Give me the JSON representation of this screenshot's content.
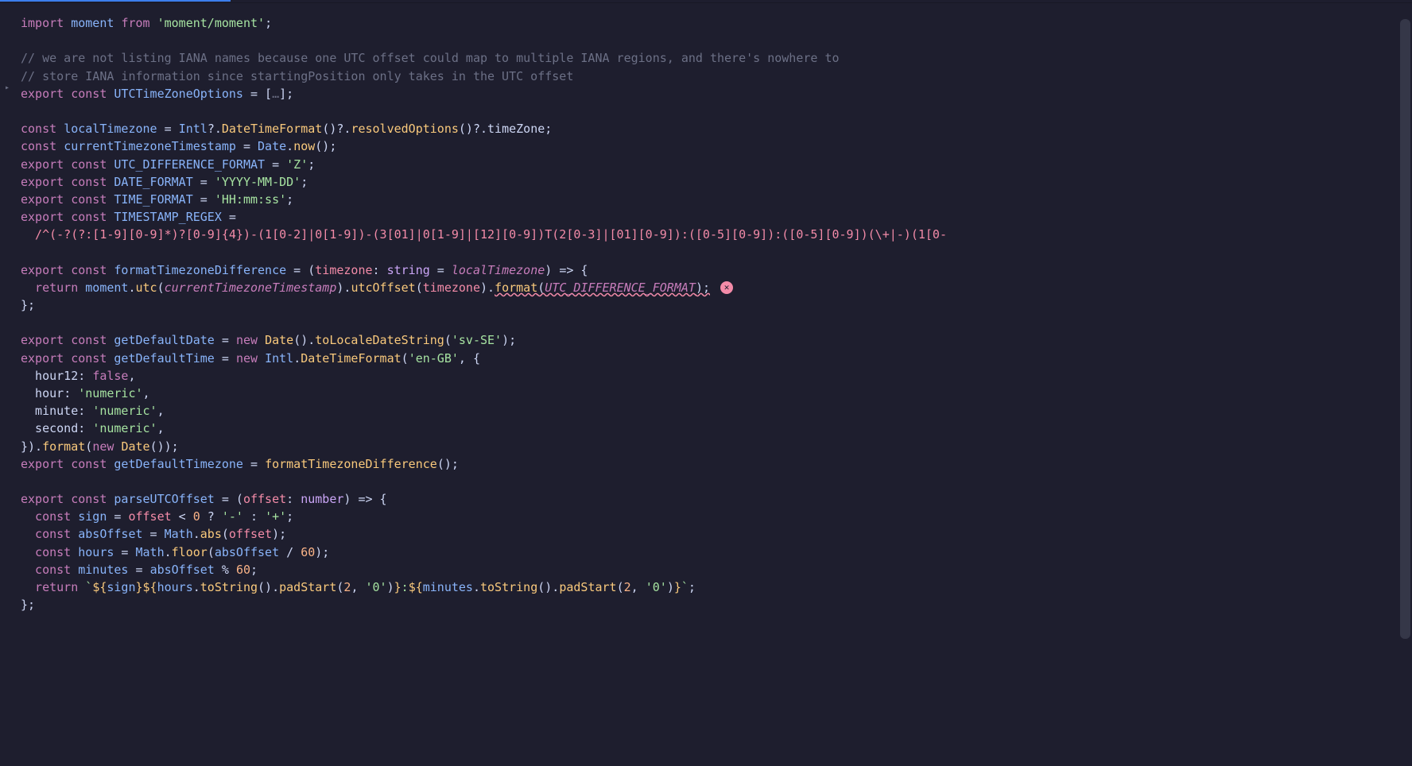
{
  "code": {
    "l1_import": "import",
    "l1_ident": "moment",
    "l1_from": "from",
    "l1_path": "'moment/moment'",
    "l1_semi": ";",
    "l3": "// we are not listing IANA names because one UTC offset could map to multiple IANA regions, and there's nowhere to",
    "l4": "// store IANA information since startingPosition only takes in the UTC offset",
    "l5_export": "export",
    "l5_const": "const",
    "l5_name": "UTCTimeZoneOptions",
    "l5_eq": " = [",
    "l5_fold": "…",
    "l5_end": "];",
    "l7_const": "const",
    "l7_name": "localTimezone",
    "l7_eq": " = ",
    "l7_intl": "Intl",
    "l7_q1": "?.",
    "l7_dtf": "DateTimeFormat",
    "l7_p1": "()?.",
    "l7_ro": "resolvedOptions",
    "l7_p2": "()?.",
    "l7_tz": "timeZone",
    "l7_semi": ";",
    "l8_const": "const",
    "l8_name": "currentTimezoneTimestamp",
    "l8_eq": " = ",
    "l8_date": "Date",
    "l8_dot": ".",
    "l8_now": "now",
    "l8_call": "();",
    "l9_export": "export",
    "l9_const": "const",
    "l9_name": "UTC_DIFFERENCE_FORMAT",
    "l9_eq": " = ",
    "l9_val": "'Z'",
    "l9_semi": ";",
    "l10_export": "export",
    "l10_const": "const",
    "l10_name": "DATE_FORMAT",
    "l10_eq": " = ",
    "l10_val": "'YYYY-MM-DD'",
    "l10_semi": ";",
    "l11_export": "export",
    "l11_const": "const",
    "l11_name": "TIME_FORMAT",
    "l11_eq": " = ",
    "l11_val": "'HH:mm:ss'",
    "l11_semi": ";",
    "l12_export": "export",
    "l12_const": "const",
    "l12_name": "TIMESTAMP_REGEX",
    "l12_eq": " =",
    "l13_regex": "  /^(-?(?:[1-9][0-9]*)?[0-9]{4})-(1[0-2]|0[1-9])-(3[01]|0[1-9]|[12][0-9])T(2[0-3]|[01][0-9]):([0-5][0-9]):([0-5][0-9])(\\+|-)(1[0-",
    "l15_export": "export",
    "l15_const": "const",
    "l15_name": "formatTimezoneDifference",
    "l15_eq": " = (",
    "l15_p": "timezone",
    "l15_colon": ": ",
    "l15_type": "string",
    "l15_def": " = ",
    "l15_defval": "localTimezone",
    "l15_arrow": ") => {",
    "l16_return": "  return ",
    "l16_moment": "moment",
    "l16_d1": ".",
    "l16_utc": "utc",
    "l16_o1": "(",
    "l16_ctt": "currentTimezoneTimestamp",
    "l16_c1": ").",
    "l16_uo": "utcOffset",
    "l16_o2": "(",
    "l16_tz": "timezone",
    "l16_c2": ").",
    "l16_fmt": "format",
    "l16_o3": "(",
    "l16_udf": "UTC_DIFFERENCE_FORMAT",
    "l16_c3": ");",
    "l17": "};",
    "l19_export": "export",
    "l19_const": "const",
    "l19_name": "getDefaultDate",
    "l19_eq": " = ",
    "l19_new": "new",
    "l19_sp": " ",
    "l19_date": "Date",
    "l19_p1": "().",
    "l19_tlds": "toLocaleDateString",
    "l19_p2": "(",
    "l19_str": "'sv-SE'",
    "l19_end": ");",
    "l20_export": "export",
    "l20_const": "const",
    "l20_name": "getDefaultTime",
    "l20_eq": " = ",
    "l20_new": "new",
    "l20_sp": " ",
    "l20_intl": "Intl",
    "l20_d": ".",
    "l20_dtf": "DateTimeFormat",
    "l20_p1": "(",
    "l20_str": "'en-GB'",
    "l20_comma": ", {",
    "l21_k": "  hour12",
    "l21_c": ": ",
    "l21_v": "false",
    "l21_e": ",",
    "l22_k": "  hour",
    "l22_c": ": ",
    "l22_v": "'numeric'",
    "l22_e": ",",
    "l23_k": "  minute",
    "l23_c": ": ",
    "l23_v": "'numeric'",
    "l23_e": ",",
    "l24_k": "  second",
    "l24_c": ": ",
    "l24_v": "'numeric'",
    "l24_e": ",",
    "l25_a": "}).",
    "l25_fmt": "format",
    "l25_p1": "(",
    "l25_new": "new",
    "l25_sp": " ",
    "l25_date": "Date",
    "l25_end": "());",
    "l26_export": "export",
    "l26_const": "const",
    "l26_name": "getDefaultTimezone",
    "l26_eq": " = ",
    "l26_fn": "formatTimezoneDifference",
    "l26_end": "();",
    "l28_export": "export",
    "l28_const": "const",
    "l28_name": "parseUTCOffset",
    "l28_eq": " = (",
    "l28_p": "offset",
    "l28_colon": ": ",
    "l28_type": "number",
    "l28_arrow": ") => {",
    "l29_const": "  const",
    "l29_name": " sign",
    "l29_eq": " = ",
    "l29_off": "offset",
    "l29_lt": " < ",
    "l29_zero": "0",
    "l29_q": " ? ",
    "l29_minus": "'-'",
    "l29_colon": " : ",
    "l29_plus": "'+'",
    "l29_semi": ";",
    "l30_const": "  const",
    "l30_name": " absOffset",
    "l30_eq": " = ",
    "l30_math": "Math",
    "l30_d": ".",
    "l30_abs": "abs",
    "l30_p1": "(",
    "l30_off": "offset",
    "l30_end": ");",
    "l31_const": "  const",
    "l31_name": " hours",
    "l31_eq": " = ",
    "l31_math": "Math",
    "l31_d": ".",
    "l31_floor": "floor",
    "l31_p1": "(",
    "l31_abs": "absOffset",
    "l31_div": " / ",
    "l31_sixty": "60",
    "l31_end": ");",
    "l32_const": "  const",
    "l32_name": " minutes",
    "l32_eq": " = ",
    "l32_abs": "absOffset",
    "l32_mod": " % ",
    "l32_sixty": "60",
    "l32_semi": ";",
    "l33_return": "  return",
    "l33_sp": " ",
    "l33_bt1": "`",
    "l33_d1": "${",
    "l33_sign": "sign",
    "l33_c1": "}",
    "l33_d2": "${",
    "l33_h": "hours",
    "l33_dot1": ".",
    "l33_ts1": "toString",
    "l33_p1": "().",
    "l33_ps1": "padStart",
    "l33_o1": "(",
    "l33_two1": "2",
    "l33_cm1": ", ",
    "l33_z1": "'0'",
    "l33_cp1": ")",
    "l33_c2": "}",
    "l33_colon": ":",
    "l33_d3": "${",
    "l33_m": "minutes",
    "l33_dot2": ".",
    "l33_ts2": "toString",
    "l33_p2": "().",
    "l33_ps2": "padStart",
    "l33_o2": "(",
    "l33_two2": "2",
    "l33_cm2": ", ",
    "l33_z2": "'0'",
    "l33_cp2": ")",
    "l33_c3": "}",
    "l33_bt2": "`",
    "l33_semi": ";",
    "l34": "};"
  },
  "error_icon": "✕"
}
